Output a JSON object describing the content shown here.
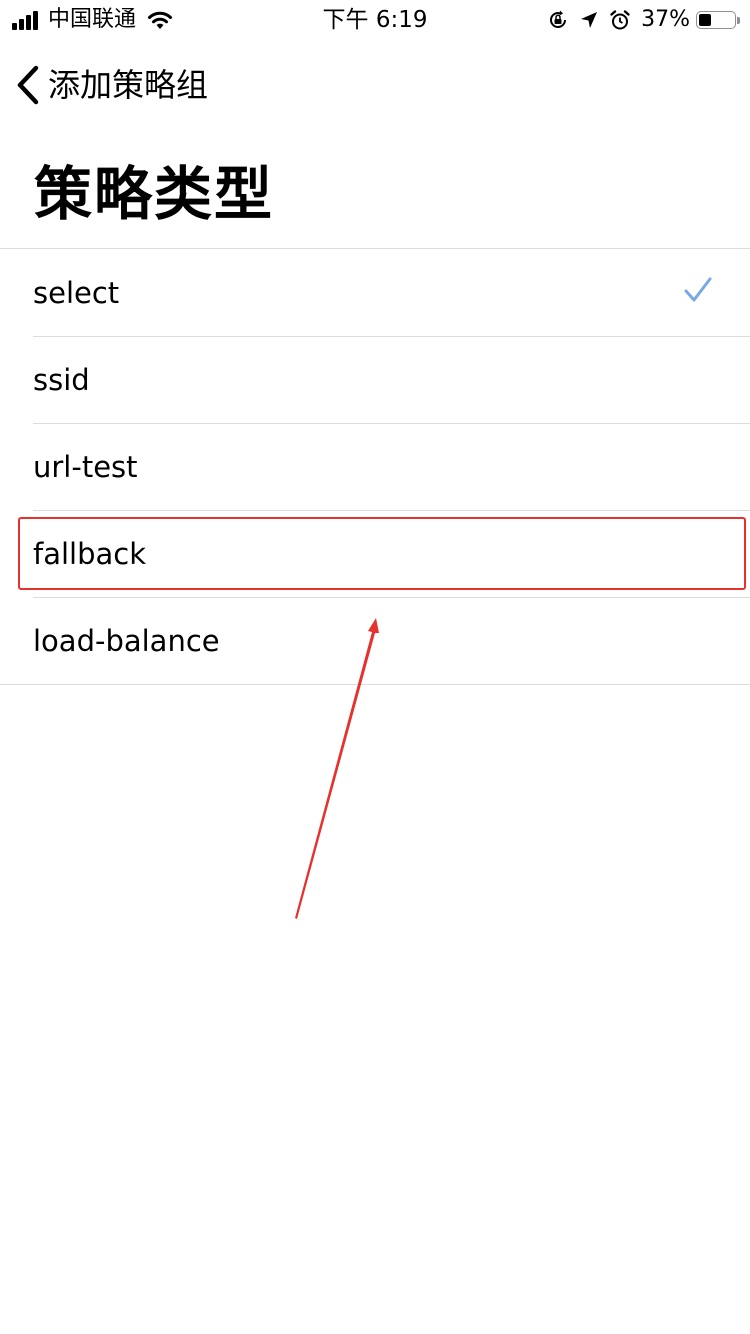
{
  "status_bar": {
    "carrier": "中国联通",
    "time": "下午 6:19",
    "battery_percent": "37%",
    "battery_level": 0.37
  },
  "nav": {
    "back_label": "添加策略组"
  },
  "page": {
    "title": "策略类型"
  },
  "policy_types": [
    {
      "label": "select",
      "selected": true
    },
    {
      "label": "ssid",
      "selected": false
    },
    {
      "label": "url-test",
      "selected": false
    },
    {
      "label": "fallback",
      "selected": false
    },
    {
      "label": "load-balance",
      "selected": false
    }
  ],
  "colors": {
    "checkmark": "#7aa7e6",
    "annotation": "#e5322d",
    "separator": "#dcdcdf"
  },
  "icons": {
    "signal": "signal-bars-icon",
    "wifi": "wifi-icon",
    "orientation_lock": "orientation-lock-icon",
    "location": "location-arrow-icon",
    "alarm": "alarm-clock-icon",
    "back": "chevron-left-icon",
    "check": "checkmark-icon"
  }
}
